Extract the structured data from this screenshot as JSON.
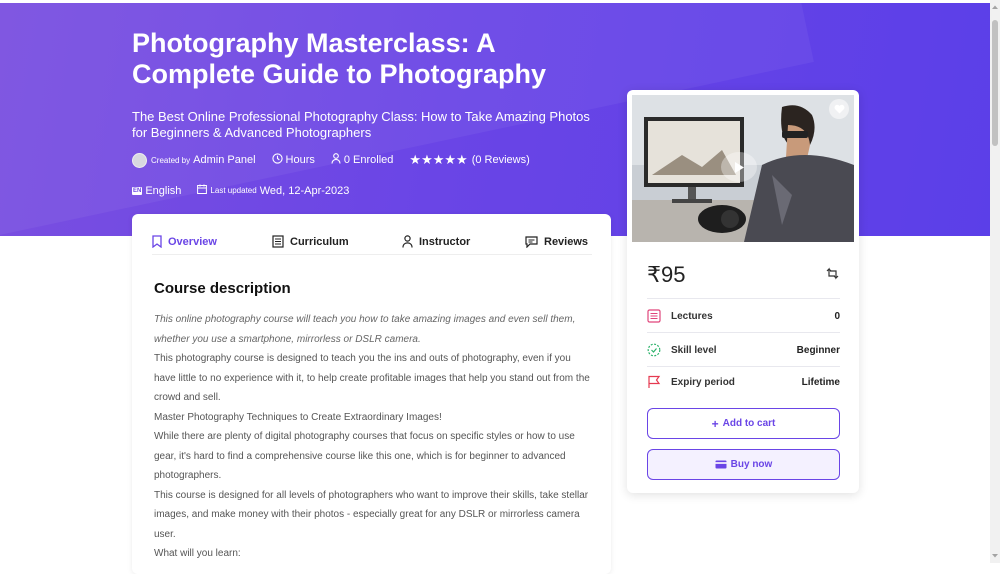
{
  "course": {
    "title": "Photography Masterclass: A Complete Guide to Photography",
    "subtitle": "The Best Online Professional Photography Class: How to Take Amazing Photos for Beginners & Advanced Photographers",
    "created_by_prefix": "Created by",
    "author": "Admin Panel",
    "hours": "Hours",
    "enrolled": "0 Enrolled",
    "rating_stars": 5,
    "reviews": "(0 Reviews)",
    "language_badge": "EN",
    "language": "English",
    "last_updated_prefix": "Last updated",
    "last_updated": "Wed, 12-Apr-2023"
  },
  "tabs": [
    {
      "label": "Overview",
      "icon": "bookmark-icon",
      "active": true
    },
    {
      "label": "Curriculum",
      "icon": "list-icon",
      "active": false
    },
    {
      "label": "Instructor",
      "icon": "user-icon",
      "active": false
    },
    {
      "label": "Reviews",
      "icon": "chat-icon",
      "active": false
    }
  ],
  "description": {
    "heading": "Course description",
    "intro": "This online photography course will teach you how to take amazing images and even sell them, whether you use a smartphone, mirrorless or DSLR camera.",
    "p1": "This photography course is designed to teach you the ins and outs of photography, even if you have little to no experience with it, to help create profitable images that help you stand out from the crowd and sell.",
    "p2": "Master Photography Techniques to Create Extraordinary Images!",
    "p3": "While there are plenty of digital photography courses that focus on specific styles or how to use gear, it's hard to find a comprehensive course like this one, which is for beginner to advanced photographers.",
    "p4": "This course is designed for all levels of photographers who want to improve their skills, take stellar images, and make money with their photos - especially great for any DSLR or mirrorless camera user.",
    "p5": "What will you learn:"
  },
  "sidebar": {
    "price": "₹95",
    "rows": [
      {
        "label": "Lectures",
        "value": "0",
        "icon": "lectures-icon",
        "color": "#e0457b"
      },
      {
        "label": "Skill level",
        "value": "Beginner",
        "icon": "skill-icon",
        "color": "#2db36b"
      },
      {
        "label": "Expiry period",
        "value": "Lifetime",
        "icon": "flag-icon",
        "color": "#e53950"
      }
    ],
    "add_to_cart": "Add to cart",
    "buy_now": "Buy now"
  },
  "colors": {
    "accent": "#6a45e6",
    "hero_start": "#7a4fe0",
    "hero_end": "#5b3fe8"
  }
}
